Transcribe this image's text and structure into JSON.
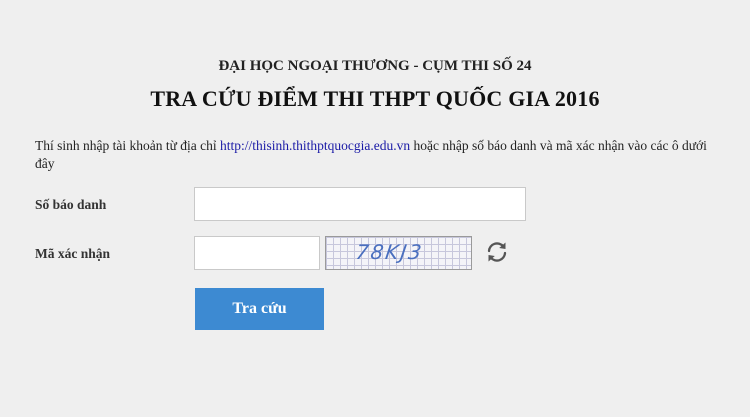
{
  "header": {
    "subtitle": "ĐẠI HỌC NGOẠI THƯƠNG - CỤM THI SỐ 24",
    "title": "TRA CỨU ĐIỂM THI THPT QUỐC GIA 2016"
  },
  "intro": {
    "before_link": "Thí sinh nhập tài khoản từ địa chỉ ",
    "link_text": "http://thisinh.thithptquocgia.edu.vn",
    "after_link": " hoặc nhập số báo danh và mã xác nhận vào các ô dưới đây"
  },
  "form": {
    "sbd_label": "Số báo danh",
    "sbd_value": "",
    "mxn_label": "Mã xác nhận",
    "mxn_value": "",
    "captcha_text": "78KJ3",
    "refresh_icon": "refresh-icon",
    "submit_label": "Tra cứu"
  },
  "colors": {
    "background": "#efefef",
    "button": "#3d8ad2",
    "link": "#1a1aa6"
  }
}
